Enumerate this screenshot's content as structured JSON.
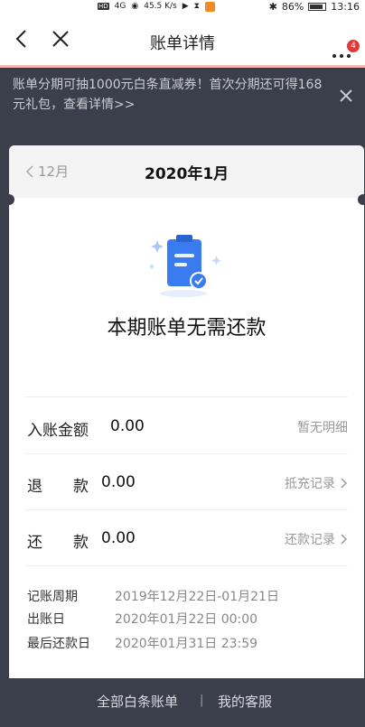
{
  "status": {
    "hd": "HD",
    "signal": "4G",
    "speed": "45.5 K/s",
    "battery": "86%",
    "time": "13:16"
  },
  "nav": {
    "title": "账单详情",
    "badge": "4"
  },
  "promo": {
    "text": "账单分期可抽1000元白条直减券！首次分期还可得168元礼包，查看详情>>"
  },
  "card": {
    "prev_month": "12月",
    "current_month": "2020年1月",
    "status_text": "本期账单无需还款",
    "rows": [
      {
        "label": "入账金额",
        "value": "0.00",
        "right": "暂无明细"
      },
      {
        "label": "退　　款",
        "value": "0.00",
        "right": "抵充记录"
      },
      {
        "label": "还　　款",
        "value": "0.00",
        "right": "还款记录"
      }
    ],
    "info": [
      {
        "label": "记账周期",
        "value": "2019年12月22日-01月21日"
      },
      {
        "label": "出账日",
        "value": "2020年01月22日 00:00"
      },
      {
        "label": "最后还款日",
        "value": "2020年01月31日 23:59"
      }
    ]
  },
  "bottom": {
    "all_bills": "全部白条账单",
    "separator": "|",
    "customer_service": "我的客服"
  },
  "colors": {
    "dark_bg": "#3b3f4c",
    "accent_blue": "#3a7bf0",
    "badge_red": "#e4393c"
  }
}
